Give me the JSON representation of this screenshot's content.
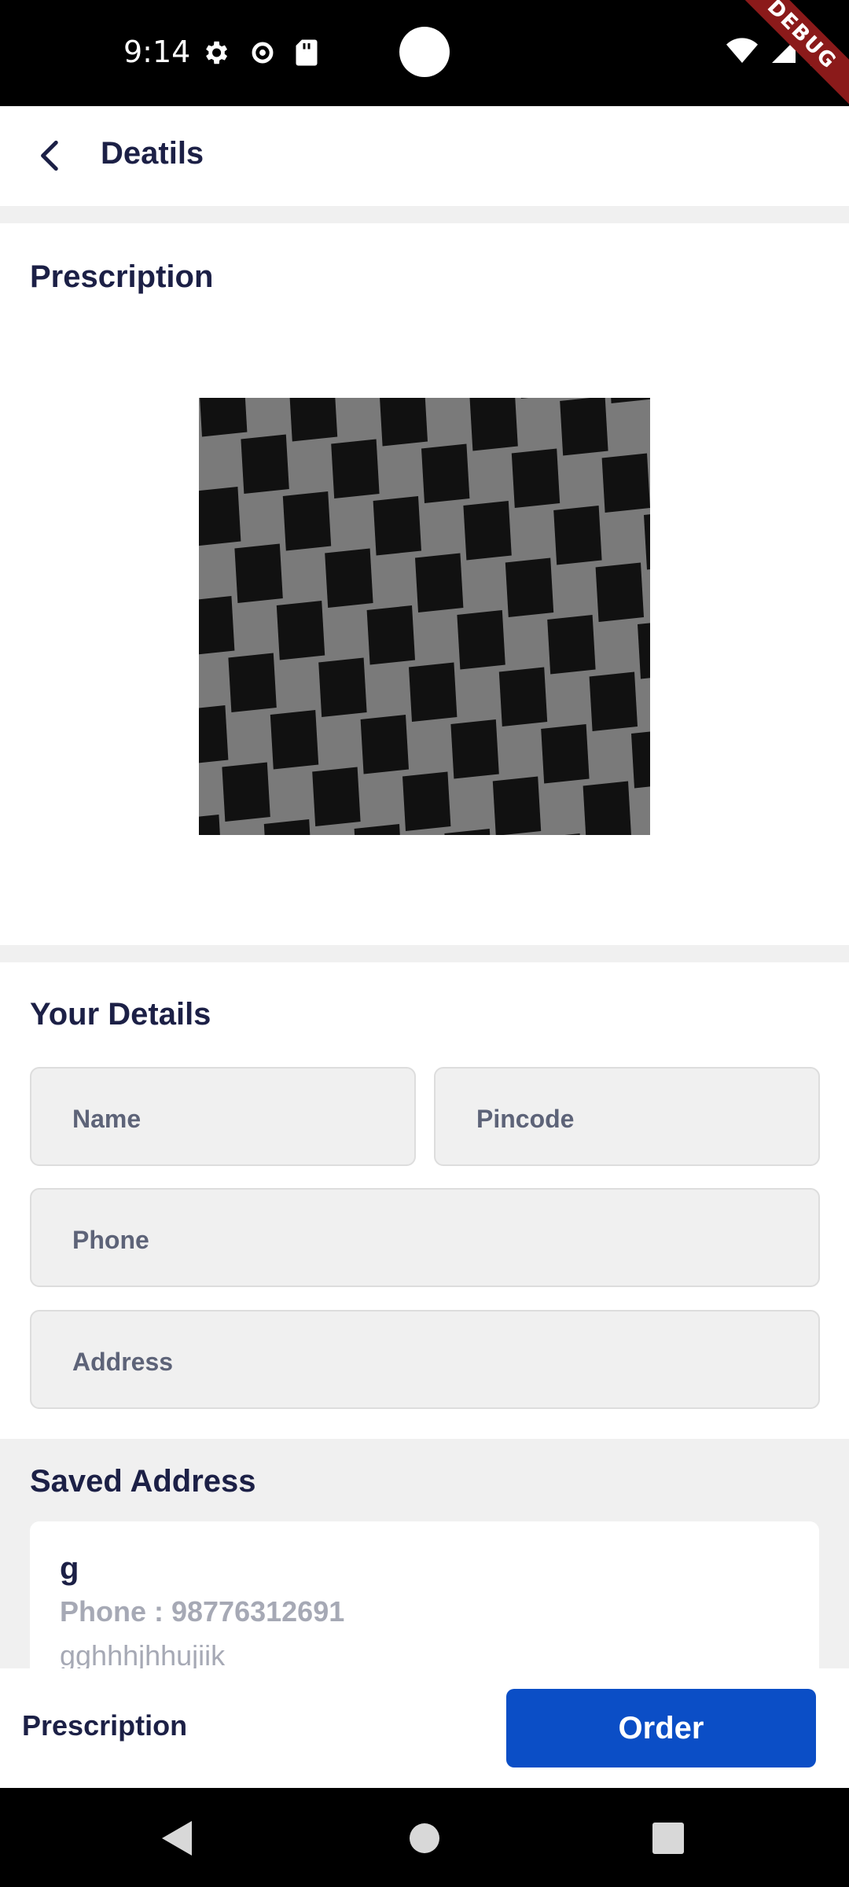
{
  "status_bar": {
    "time": "9:14",
    "debug_label": "DEBUG",
    "left_icons": [
      "gear-icon",
      "gear-outline-icon",
      "sd-card-icon"
    ],
    "right_icons": [
      "wifi-icon",
      "signal-icon",
      "battery-icon"
    ]
  },
  "app_bar": {
    "title": "Deatils",
    "back_icon": "back-arrow-icon"
  },
  "prescription_section": {
    "title": "Prescription",
    "image": "prescription-image"
  },
  "details_section": {
    "title": "Your Details",
    "fields": {
      "name": {
        "placeholder": "Name",
        "value": ""
      },
      "pincode": {
        "placeholder": "Pincode",
        "value": ""
      },
      "phone": {
        "placeholder": "Phone",
        "value": ""
      },
      "address": {
        "placeholder": "Address",
        "value": ""
      }
    }
  },
  "saved_address": {
    "title": "Saved Address",
    "card": {
      "name": "g",
      "phone": "Phone : 98776312691",
      "address": "gghhhjhhujiik"
    }
  },
  "bottom_bar": {
    "prescription_label": "Prescription",
    "order_label": "Order"
  },
  "colors": {
    "primary": "#0b4ec6",
    "heading": "#1c2046",
    "muted": "#a6a9b5",
    "field_bg": "#f0f0f0"
  }
}
